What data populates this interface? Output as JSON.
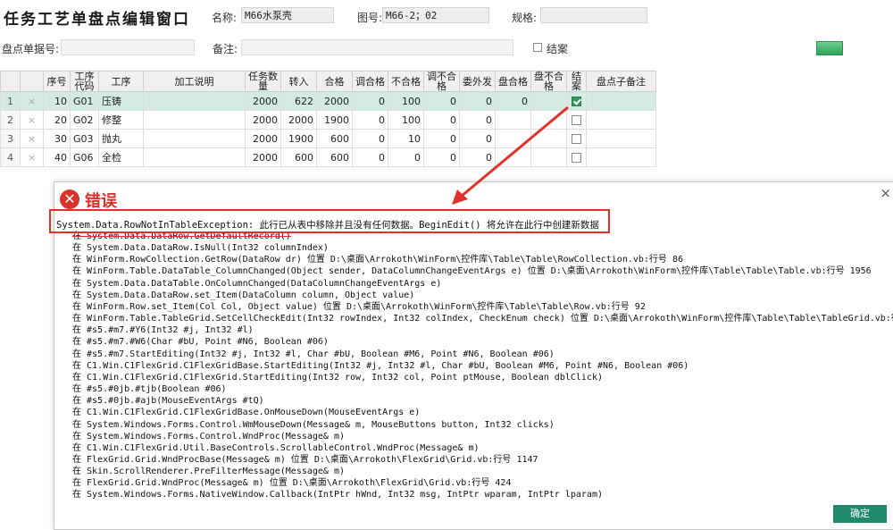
{
  "header": {
    "title": "任务工艺单盘点编辑窗口",
    "name_label": "名称:",
    "name_value": "M66水泵壳",
    "drawing_label": "图号:",
    "drawing_value": "M66-2；02",
    "spec_label": "规格:",
    "spec_value": ""
  },
  "row2": {
    "order_label": "盘点单据号:",
    "order_value": "",
    "note_label": "备注:",
    "note_value": "",
    "closed_label": "结案"
  },
  "grid": {
    "columns": [
      "",
      "",
      "序号",
      "工序代码",
      "工序",
      "加工说明",
      "任务数量",
      "转入",
      "合格",
      "调合格",
      "不合格",
      "调不合格",
      "委外发",
      "盘合格",
      "盘不合格",
      "结案",
      "盘点子备注"
    ],
    "rows": [
      {
        "idx": "1",
        "seq": "10",
        "code": "G01",
        "proc": "压铸",
        "desc": "",
        "qty": "2000",
        "in": "622",
        "ok": "2000",
        "adj_ok": "0",
        "ng": "100",
        "adj_ng": "0",
        "out": "0",
        "inv_ok": "0",
        "inv_ng": "",
        "closed": true,
        "remark": ""
      },
      {
        "idx": "2",
        "seq": "20",
        "code": "G02",
        "proc": "修整",
        "desc": "",
        "qty": "2000",
        "in": "2000",
        "ok": "1900",
        "adj_ok": "0",
        "ng": "100",
        "adj_ng": "0",
        "out": "0",
        "inv_ok": "",
        "inv_ng": "",
        "closed": false,
        "remark": ""
      },
      {
        "idx": "3",
        "seq": "30",
        "code": "G03",
        "proc": "抛丸",
        "desc": "",
        "qty": "2000",
        "in": "1900",
        "ok": "600",
        "adj_ok": "0",
        "ng": "10",
        "adj_ng": "0",
        "out": "0",
        "inv_ok": "",
        "inv_ng": "",
        "closed": false,
        "remark": ""
      },
      {
        "idx": "4",
        "seq": "40",
        "code": "G06",
        "proc": "全检",
        "desc": "",
        "qty": "2000",
        "in": "600",
        "ok": "600",
        "adj_ok": "0",
        "ng": "0",
        "adj_ng": "0",
        "out": "0",
        "inv_ok": "",
        "inv_ng": "",
        "closed": false,
        "remark": ""
      }
    ]
  },
  "dialog": {
    "title": "错误",
    "exception": "System.Data.RowNotInTableException: 此行已从表中移除并且没有任何数据。BeginEdit() 将允许在此行中创建新数据",
    "stack": [
      "在 System.Data.DataRow.GetDefaultRecord()",
      "在 System.Data.DataRow.IsNull(Int32 columnIndex)",
      "在 WinForm.RowCollection.GetRow(DataRow dr) 位置 D:\\桌面\\Arrokoth\\WinForm\\控件库\\Table\\Table\\RowCollection.vb:行号 86",
      "在 WinForm.Table.DataTable_ColumnChanged(Object sender, DataColumnChangeEventArgs e) 位置 D:\\桌面\\Arrokoth\\WinForm\\控件库\\Table\\Table\\Table.vb:行号 1956",
      "在 System.Data.DataTable.OnColumnChanged(DataColumnChangeEventArgs e)",
      "在 System.Data.DataRow.set_Item(DataColumn column, Object value)",
      "在 WinForm.Row.set_Item(Col Col, Object value) 位置 D:\\桌面\\Arrokoth\\WinForm\\控件库\\Table\\Table\\Row.vb:行号 92",
      "在 WinForm.Table.TableGrid.SetCellCheckEdit(Int32 rowIndex, Int32 colIndex, CheckEnum check) 位置 D:\\桌面\\Arrokoth\\WinForm\\控件库\\Table\\Table\\TableGrid.vb:行号 83",
      "在 #s5.#m7.#Y6(Int32 #j, Int32 #l)",
      "在 #s5.#m7.#W6(Char #bU, Point #N6, Boolean #06)",
      "在 #s5.#m7.StartEditing(Int32 #j, Int32 #l, Char #bU, Boolean #M6, Point #N6, Boolean #06)",
      "在 C1.Win.C1FlexGrid.C1FlexGridBase.StartEditing(Int32 #j, Int32 #l, Char #bU, Boolean #M6, Point #N6, Boolean #06)",
      "在 C1.Win.C1FlexGrid.C1FlexGrid.StartEditing(Int32 row, Int32 col, Point ptMouse, Boolean dblClick)",
      "在 #s5.#0jb.#tjb(Boolean #06)",
      "在 #s5.#0jb.#ajb(MouseEventArgs #tQ)",
      "在 C1.Win.C1FlexGrid.C1FlexGridBase.OnMouseDown(MouseEventArgs e)",
      "在 System.Windows.Forms.Control.WmMouseDown(Message& m, MouseButtons button, Int32 clicks)",
      "在 System.Windows.Forms.Control.WndProc(Message& m)",
      "在 C1.Win.C1FlexGrid.Util.BaseControls.ScrollableControl.WndProc(Message& m)",
      "在 FlexGrid.Grid.WndProcBase(Message& m) 位置 D:\\桌面\\Arrokoth\\FlexGrid\\Grid.vb:行号 1147",
      "在 Skin.ScrollRenderer.PreFilterMessage(Message& m)",
      "在 FlexGrid.Grid.WndProc(Message& m) 位置 D:\\桌面\\Arrokoth\\FlexGrid\\Grid.vb:行号 424",
      "在 System.Windows.Forms.NativeWindow.Callback(IntPtr hWnd, Int32 msg, IntPtr wparam, IntPtr lparam)"
    ],
    "ok_label": "确定",
    "close_glyph": "×",
    "icon_glyph": "✕"
  }
}
